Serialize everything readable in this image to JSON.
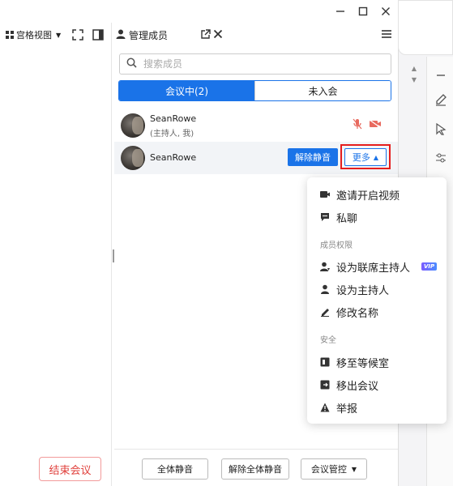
{
  "left_panel": {
    "view_mode_label": "宫格视图",
    "end_meeting_label": "结束会议"
  },
  "members_panel": {
    "title": "管理成员",
    "search_placeholder": "搜索成员",
    "tabs": [
      {
        "label": "会议中(2)",
        "active": true
      },
      {
        "label": "未入会",
        "active": false
      }
    ],
    "members": [
      {
        "name": "SeanRowe",
        "role": "(主持人, 我)"
      },
      {
        "name": "SeanRowe",
        "role": ""
      }
    ],
    "unmute_label": "解除静音",
    "more_label": "更多",
    "bottom": {
      "mute_all_label": "全体静音",
      "unmute_all_label": "解除全体静音",
      "control_label": "会议管控"
    }
  },
  "dropdown": {
    "items_top": [
      {
        "label": "邀请开启视频",
        "icon": "video-icon"
      },
      {
        "label": "私聊",
        "icon": "chat-icon"
      }
    ],
    "section_permissions": "成员权限",
    "items_permissions": [
      {
        "label": "设为联席主持人",
        "icon": "cohost-icon",
        "badge": "VIP"
      },
      {
        "label": "设为主持人",
        "icon": "host-icon"
      },
      {
        "label": "修改名称",
        "icon": "edit-icon"
      }
    ],
    "section_security": "安全",
    "items_security": [
      {
        "label": "移至等候室",
        "icon": "waiting-room-icon"
      },
      {
        "label": "移出会议",
        "icon": "remove-icon"
      },
      {
        "label": "举报",
        "icon": "report-icon"
      }
    ]
  },
  "colors": {
    "accent": "#1a73e8",
    "danger": "#e0403c",
    "highlight_box": "#e51d1d"
  }
}
